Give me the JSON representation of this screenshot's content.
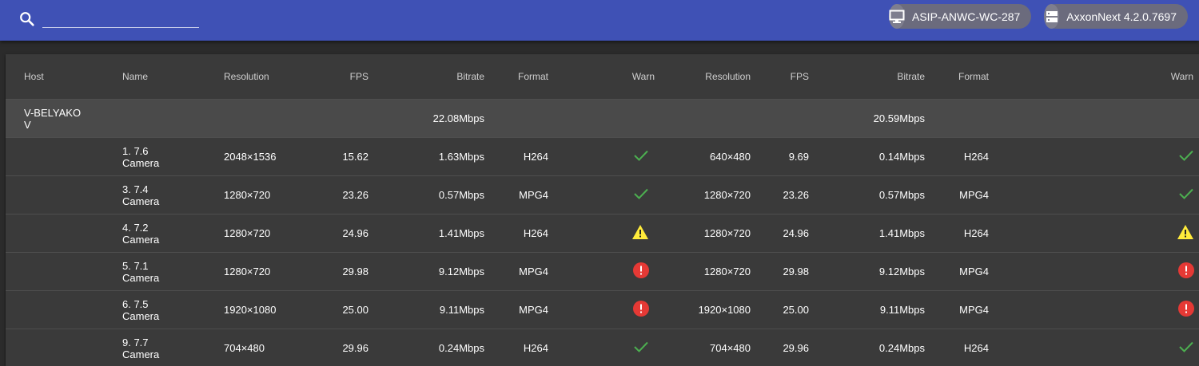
{
  "search": {
    "placeholder": "",
    "value": ""
  },
  "header": {
    "host_chip": {
      "label": "ASIP-ANWC-WC-287",
      "icon": "monitor-icon"
    },
    "version_chip": {
      "label": "AxxonNext 4.2.0.7697",
      "icon": "server-icon"
    }
  },
  "table": {
    "columns": [
      "Host",
      "Name",
      "Resolution",
      "FPS",
      "Bitrate",
      "Format",
      "Warn",
      "Resolution",
      "FPS",
      "Bitrate",
      "Format",
      "Warn"
    ],
    "group": {
      "host": "V-BELYAKOV",
      "bitrate1": "22.08Mbps",
      "bitrate2": "20.59Mbps"
    },
    "rows": [
      {
        "name": "1. 7.6 Camera",
        "res1": "2048×1536",
        "fps1": "15.62",
        "bitrate1": "1.63Mbps",
        "format1": "H264",
        "warn1": "ok",
        "res2": "640×480",
        "fps2": "9.69",
        "bitrate2": "0.14Mbps",
        "format2": "H264",
        "warn2": "ok"
      },
      {
        "name": "3. 7.4 Camera",
        "res1": "1280×720",
        "fps1": "23.26",
        "bitrate1": "0.57Mbps",
        "format1": "MPG4",
        "warn1": "ok",
        "res2": "1280×720",
        "fps2": "23.26",
        "bitrate2": "0.57Mbps",
        "format2": "MPG4",
        "warn2": "ok"
      },
      {
        "name": "4. 7.2 Camera",
        "res1": "1280×720",
        "fps1": "24.96",
        "bitrate1": "1.41Mbps",
        "format1": "H264",
        "warn1": "warning",
        "res2": "1280×720",
        "fps2": "24.96",
        "bitrate2": "1.41Mbps",
        "format2": "H264",
        "warn2": "warning"
      },
      {
        "name": "5. 7.1 Camera",
        "res1": "1280×720",
        "fps1": "29.98",
        "bitrate1": "9.12Mbps",
        "format1": "MPG4",
        "warn1": "error",
        "res2": "1280×720",
        "fps2": "29.98",
        "bitrate2": "9.12Mbps",
        "format2": "MPG4",
        "warn2": "error"
      },
      {
        "name": "6. 7.5 Camera",
        "res1": "1920×1080",
        "fps1": "25.00",
        "bitrate1": "9.11Mbps",
        "format1": "MPG4",
        "warn1": "error",
        "res2": "1920×1080",
        "fps2": "25.00",
        "bitrate2": "9.11Mbps",
        "format2": "MPG4",
        "warn2": "error"
      },
      {
        "name": "9. 7.7 Camera",
        "res1": "704×480",
        "fps1": "29.96",
        "bitrate1": "0.24Mbps",
        "format1": "H264",
        "warn1": "ok",
        "res2": "704×480",
        "fps2": "29.96",
        "bitrate2": "0.24Mbps",
        "format2": "H264",
        "warn2": "ok"
      }
    ]
  },
  "colors": {
    "topbar": "#3f51b5",
    "ok": "#4caf50",
    "warning": "#ffeb3b",
    "error": "#e53935"
  }
}
